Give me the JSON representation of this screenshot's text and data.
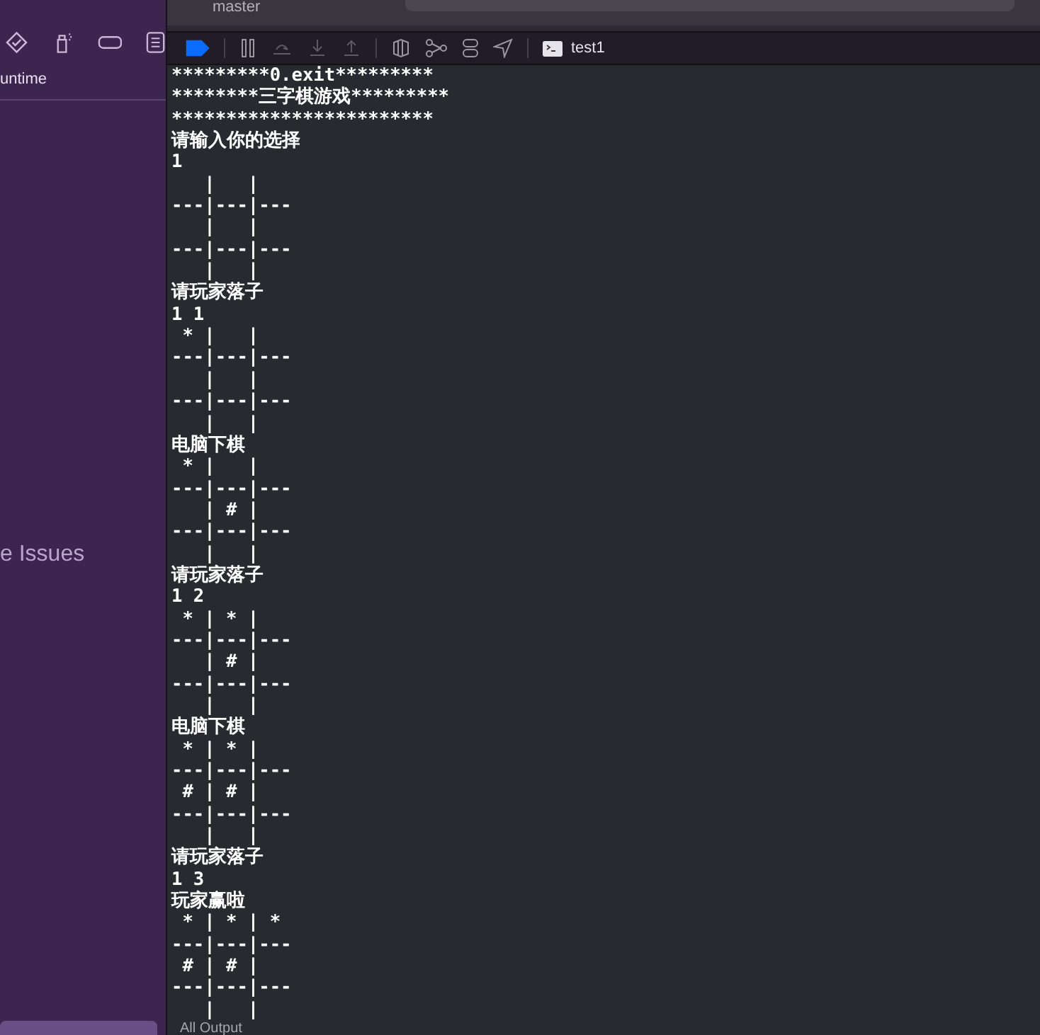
{
  "top_bar": {
    "branch": "master"
  },
  "sidebar": {
    "row_label": "untime",
    "issues_label": "e Issues"
  },
  "debug_bar": {
    "breakpoints_on": true,
    "target": "test1"
  },
  "console": {
    "lines": [
      "*********0.exit*********",
      "********三字棋游戏*********",
      "************************",
      "请输入你的选择",
      "1",
      "   |   |   ",
      "---|---|---",
      "   |   |   ",
      "---|---|---",
      "   |   |   ",
      "请玩家落子",
      "1 1",
      " * |   |   ",
      "---|---|---",
      "   |   |   ",
      "---|---|---",
      "   |   |   ",
      "电脑下棋",
      " * |   |   ",
      "---|---|---",
      "   | # |   ",
      "---|---|---",
      "   |   |   ",
      "请玩家落子",
      "1 2",
      " * | * |   ",
      "---|---|---",
      "   | # |   ",
      "---|---|---",
      "   |   |   ",
      "电脑下棋",
      " * | * |   ",
      "---|---|---",
      " # | # |   ",
      "---|---|---",
      "   |   |   ",
      "请玩家落子",
      "1 3",
      "玩家赢啦",
      " * | * | * ",
      "---|---|---",
      " # | # |   ",
      "---|---|---",
      "   |   |   "
    ]
  },
  "footer": {
    "filter": "All Output"
  }
}
